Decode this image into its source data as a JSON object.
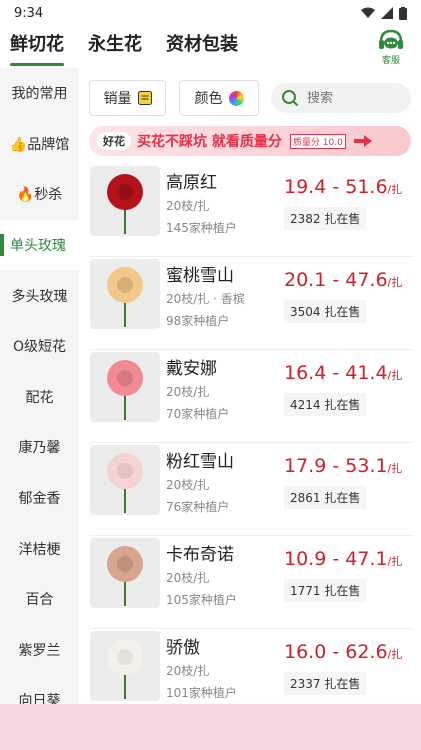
{
  "status": {
    "time": "9:34"
  },
  "top_tabs": [
    {
      "label": "鲜切花",
      "active": true
    },
    {
      "label": "永生花",
      "active": false
    },
    {
      "label": "资材包装",
      "active": false
    }
  ],
  "service": {
    "label": "客服"
  },
  "sidebar": {
    "items": [
      {
        "label": "我的常用"
      },
      {
        "label": "👍品牌馆"
      },
      {
        "label": "🔥秒杀"
      },
      {
        "label": "单头玫瑰",
        "active": true
      },
      {
        "label": "多头玫瑰"
      },
      {
        "label": "O级短花"
      },
      {
        "label": "配花"
      },
      {
        "label": "康乃馨"
      },
      {
        "label": "郁金香"
      },
      {
        "label": "洋桔梗"
      },
      {
        "label": "百合"
      },
      {
        "label": "紫罗兰"
      },
      {
        "label": "向日葵"
      }
    ]
  },
  "filters": {
    "sales_label": "销量",
    "color_label": "颜色",
    "search_placeholder": "搜索"
  },
  "banner": {
    "badge": "好花",
    "text": "买花不踩坑  就看质量分",
    "score_label": "质量分",
    "score_value": "10.0"
  },
  "products": [
    {
      "name": "高原红",
      "spec": "20枝/扎",
      "growers": "145家种植户",
      "price": "19.4 - 51.6",
      "unit": "/扎",
      "sales": "2382 扎在售",
      "color": "#b5121b"
    },
    {
      "name": "蜜桃雪山",
      "spec": "20枝/扎 · 香槟",
      "growers": "98家种植户",
      "price": "20.1 - 47.6",
      "unit": "/扎",
      "sales": "3504 扎在售",
      "color": "#f2c98a"
    },
    {
      "name": "戴安娜",
      "spec": "20枝/扎",
      "growers": "70家种植户",
      "price": "16.4 - 41.4",
      "unit": "/扎",
      "sales": "4214 扎在售",
      "color": "#f28a93"
    },
    {
      "name": "粉红雪山",
      "spec": "20枝/扎",
      "growers": "76家种植户",
      "price": "17.9 - 53.1",
      "unit": "/扎",
      "sales": "2861 扎在售",
      "color": "#f6d3d3"
    },
    {
      "name": "卡布奇诺",
      "spec": "20枝/扎",
      "growers": "105家种植户",
      "price": "10.9 - 47.1",
      "unit": "/扎",
      "sales": "1771 扎在售",
      "color": "#d8a58f"
    },
    {
      "name": "骄傲",
      "spec": "20枝/扎",
      "growers": "101家种植户",
      "price": "16.0 - 62.6",
      "unit": "/扎",
      "sales": "2337 扎在售",
      "color": "#f3f1ea"
    }
  ]
}
